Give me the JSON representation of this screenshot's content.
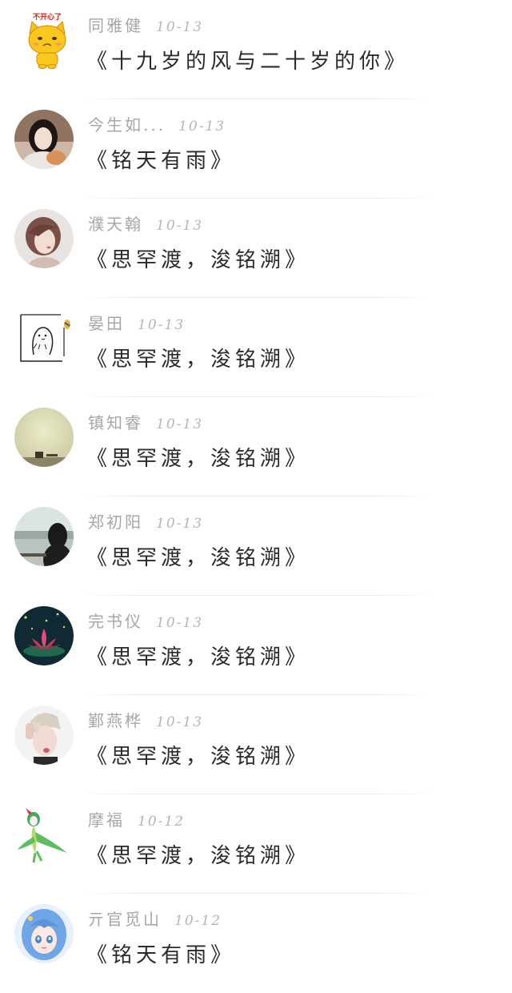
{
  "comments": [
    {
      "name": "同雅健",
      "date": "10-13",
      "title": "《十九岁的风与二十岁的你》",
      "avatar_icon": "cartoon-cat-icon",
      "avatar_label": "不开心了"
    },
    {
      "name": "今生如...",
      "date": "10-13",
      "title": "《铭天有雨》",
      "avatar_icon": "girl-photo-icon"
    },
    {
      "name": "濮天翰",
      "date": "10-13",
      "title": "《思罕渡，浚铭溯》",
      "avatar_icon": "illustrated-girl-icon"
    },
    {
      "name": "晏田",
      "date": "10-13",
      "title": "《思罕渡，浚铭溯》",
      "avatar_icon": "cartoon-doodle-icon"
    },
    {
      "name": "镇知睿",
      "date": "10-13",
      "title": "《思罕渡，浚铭溯》",
      "avatar_icon": "misty-landscape-icon"
    },
    {
      "name": "郑初阳",
      "date": "10-13",
      "title": "《思罕渡，浚铭溯》",
      "avatar_icon": "lake-silhouette-icon"
    },
    {
      "name": "完书仪",
      "date": "10-13",
      "title": "《思罕渡，浚铭溯》",
      "avatar_icon": "lotus-icon"
    },
    {
      "name": "鄞燕桦",
      "date": "10-13",
      "title": "《思罕渡，浚铭溯》",
      "avatar_icon": "portrait-photo-icon"
    },
    {
      "name": "摩福",
      "date": "10-12",
      "title": "《思罕渡，浚铭溯》",
      "avatar_icon": "green-fairy-icon"
    },
    {
      "name": "亓官觅山",
      "date": "10-12",
      "title": "《铭天有雨》",
      "avatar_icon": "anime-girl-icon"
    }
  ]
}
